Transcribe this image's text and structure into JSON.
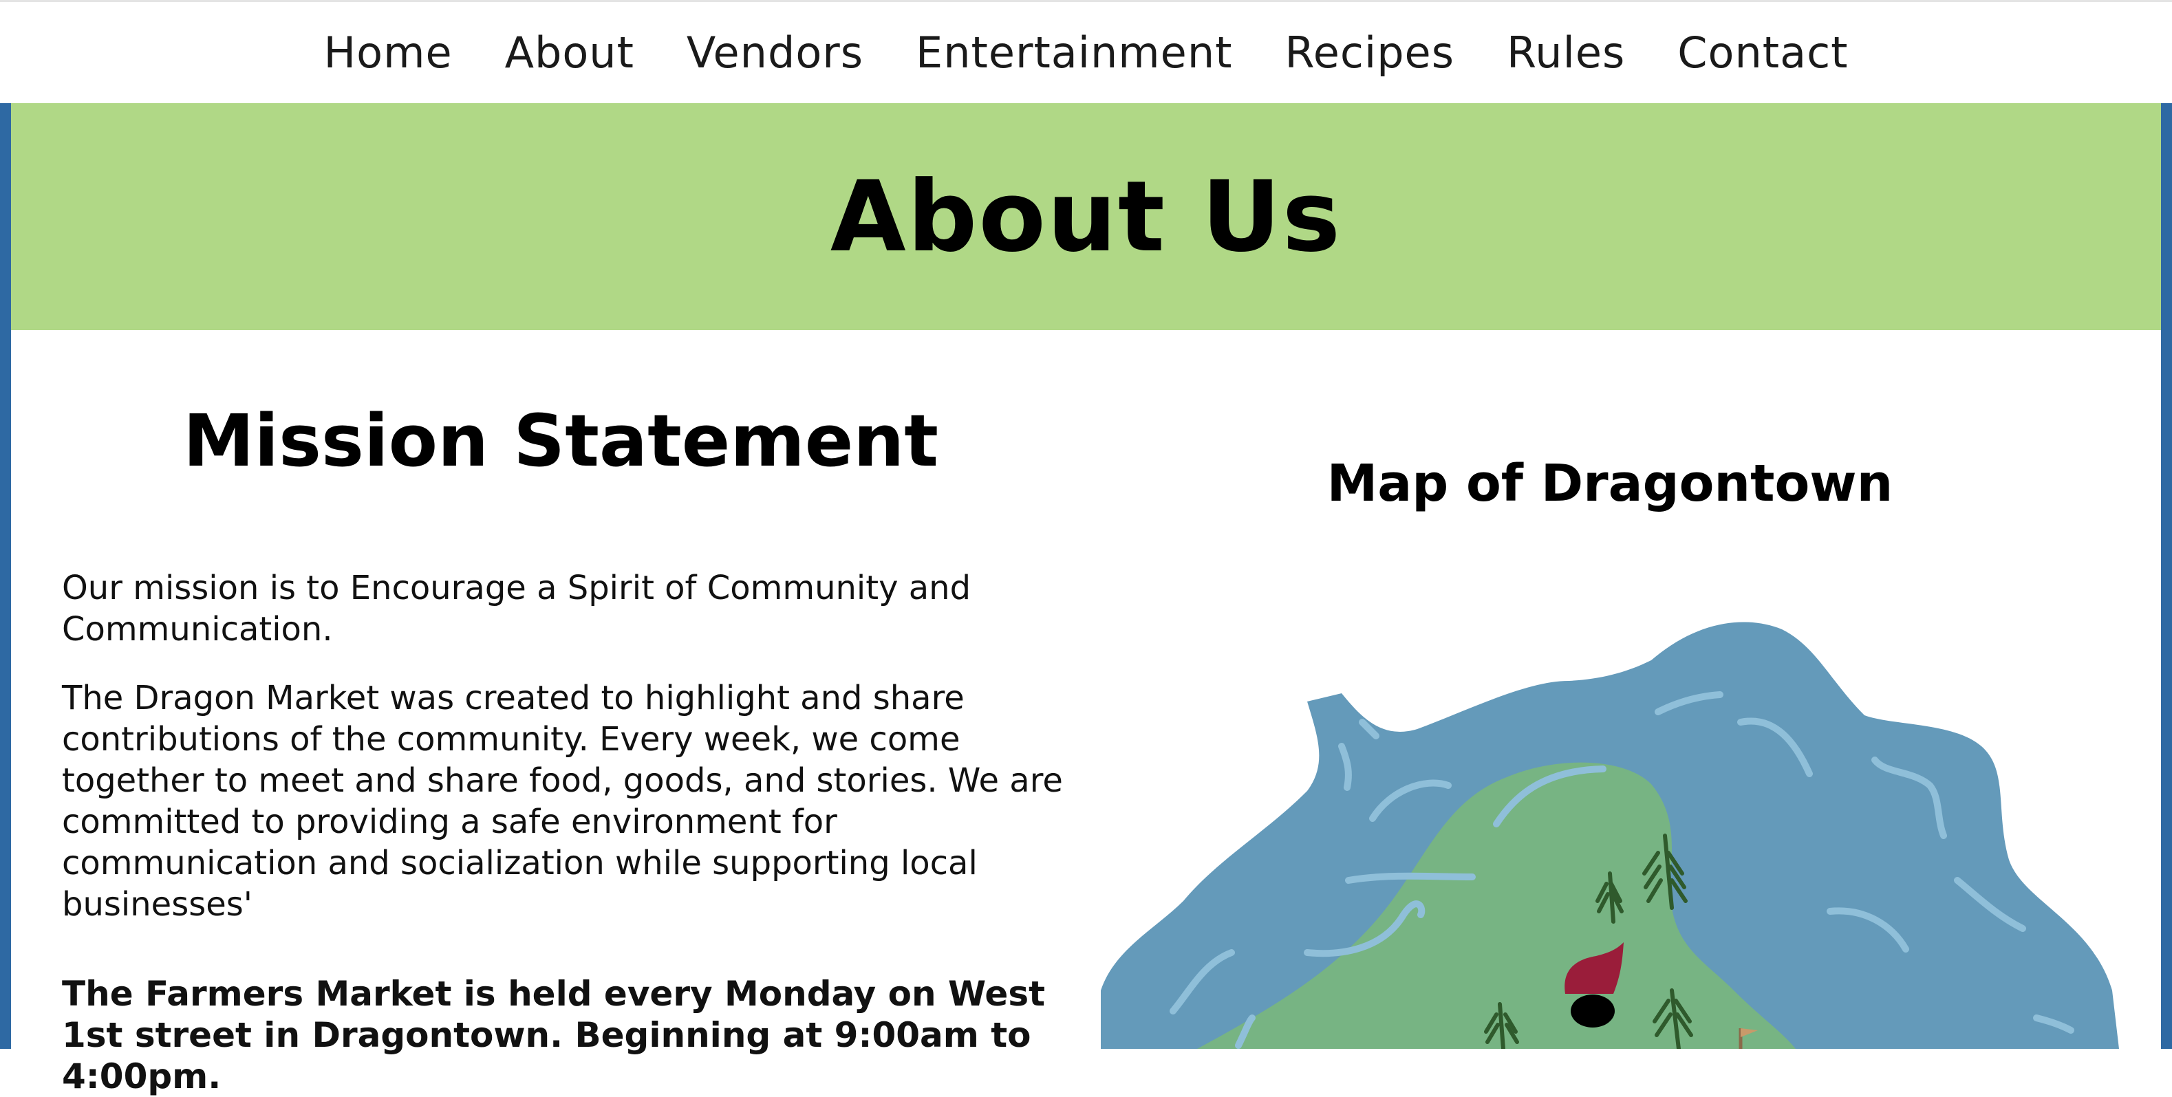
{
  "nav": {
    "items": [
      "Home",
      "About",
      "Vendors",
      "Entertainment",
      "Recipes",
      "Rules",
      "Contact"
    ]
  },
  "banner": {
    "title": "About Us"
  },
  "mission": {
    "title": "Mission Statement",
    "paragraph1": "Our mission is to Encourage a Spirit of Community and Communication.",
    "paragraph2": "The Dragon Market was created to highlight and share contributions of the community. Every week, we come together to meet and share food, goods, and stories. We are committed to providing a safe environment for communication and socialization while supporting local businesses'",
    "paragraph3": "The Farmers Market is held every Monday on West 1st street in Dragontown. Beginning at 9:00am to 4:00pm."
  },
  "map": {
    "title": "Map of Dragontown"
  },
  "colors": {
    "banner": "#b0d886",
    "frame": "#2e69a3",
    "water": "#649aba",
    "land": "#77b483",
    "dragon": "#9a1d3a"
  }
}
